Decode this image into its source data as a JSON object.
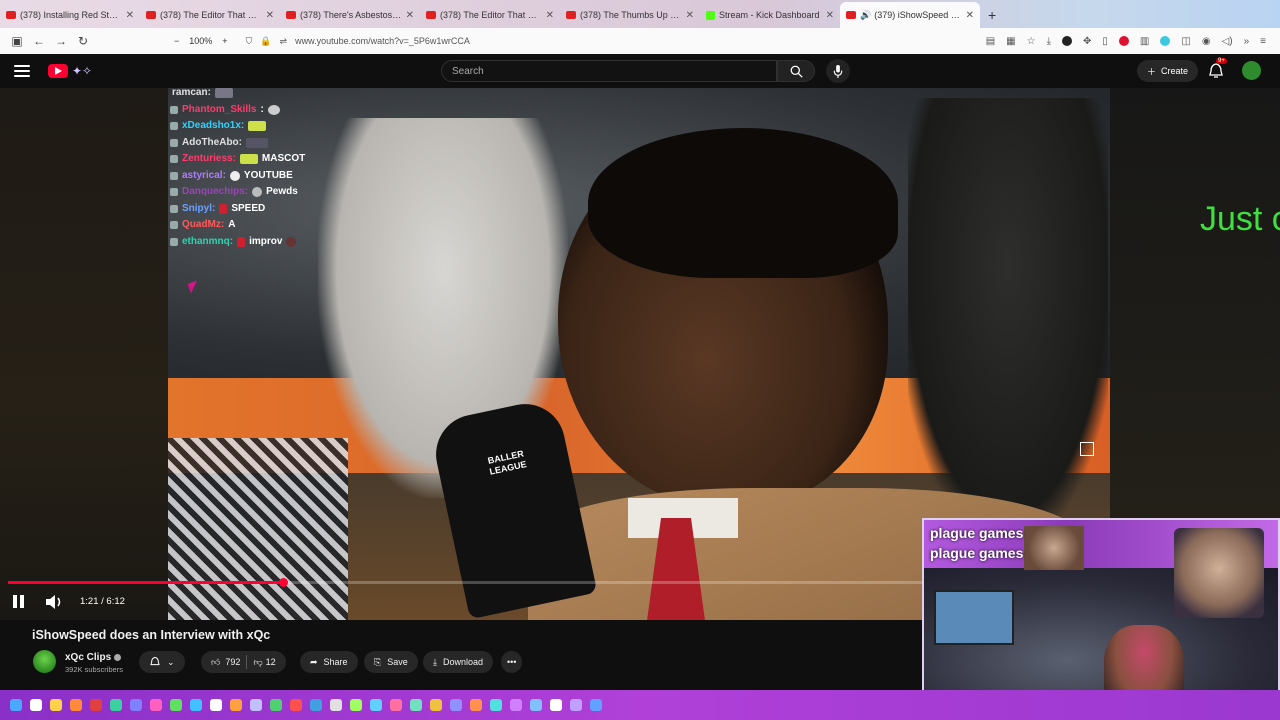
{
  "browser": {
    "tabs": [
      {
        "title": "(378) Installing Red Star OS on",
        "icon": "youtube-icon"
      },
      {
        "title": "(378) The Editor That Made Asn",
        "icon": "youtube-icon"
      },
      {
        "title": "(378) There's Asbestos in the T",
        "icon": "youtube-icon"
      },
      {
        "title": "(378) The Editor That Made Ac",
        "icon": "youtube-icon"
      },
      {
        "title": "(378) The Thumbs Up Kid Mem",
        "icon": "youtube-icon"
      },
      {
        "title": "Stream - Kick Dashboard",
        "icon": "kick-icon"
      },
      {
        "title": "(379) iShowSpeed does an",
        "icon": "youtube-icon",
        "active": true
      }
    ],
    "zoom": "100%",
    "url": "www.youtube.com/watch?v=_5P6w1wrCCA"
  },
  "yt": {
    "search_placeholder": "Search",
    "create_label": "Create",
    "notif_count": "9+"
  },
  "chat": [
    {
      "user": "ramcan:",
      "user_color": "#e0e0e0",
      "msg": "",
      "emote": true
    },
    {
      "user": "Phantom_Skills",
      "user_color": "#ff3b6b",
      "msg": ":",
      "emote": true
    },
    {
      "user": "xDeadsho1x:",
      "user_color": "#2bd4ff",
      "msg": "",
      "emote": true
    },
    {
      "user": "AdoTheAbo:",
      "user_color": "#e0e0e0",
      "msg": "",
      "emote": true
    },
    {
      "user": "Zenturiess:",
      "user_color": "#ff3b6b",
      "msg": "MASCOT",
      "emote": true
    },
    {
      "user": "astyrical:",
      "user_color": "#b07cff",
      "msg": "YOUTUBE",
      "emote": true
    },
    {
      "user": "Danquechips:",
      "user_color": "#a040c0",
      "msg": "Pewds",
      "emote": true
    },
    {
      "user": "Snipyl:",
      "user_color": "#6aa0ff",
      "msg": "SPEED",
      "emote": true
    },
    {
      "user": "QuadMz:",
      "user_color": "#ff5a5a",
      "msg": "A",
      "emote": false
    },
    {
      "user": "ethanmnq:",
      "user_color": "#2bd4b0",
      "msg": "improv",
      "emote": true
    }
  ],
  "overlay_text": "Just c",
  "mic_brand": "BALLER LEAGUE",
  "player": {
    "time": "1:21 / 6:12",
    "progress": 0.2177
  },
  "video": {
    "title": "iShowSpeed does an Interview with xQc",
    "channel": "xQc Clips",
    "subscribers": "392K subscribers",
    "likes": "792",
    "dislikes": "12",
    "share_label": "Share",
    "save_label": "Save",
    "download_label": "Download"
  },
  "pip": {
    "label": "plague games"
  },
  "colors": {
    "accent": "#ff0033",
    "taskbar": "#b040d8"
  }
}
